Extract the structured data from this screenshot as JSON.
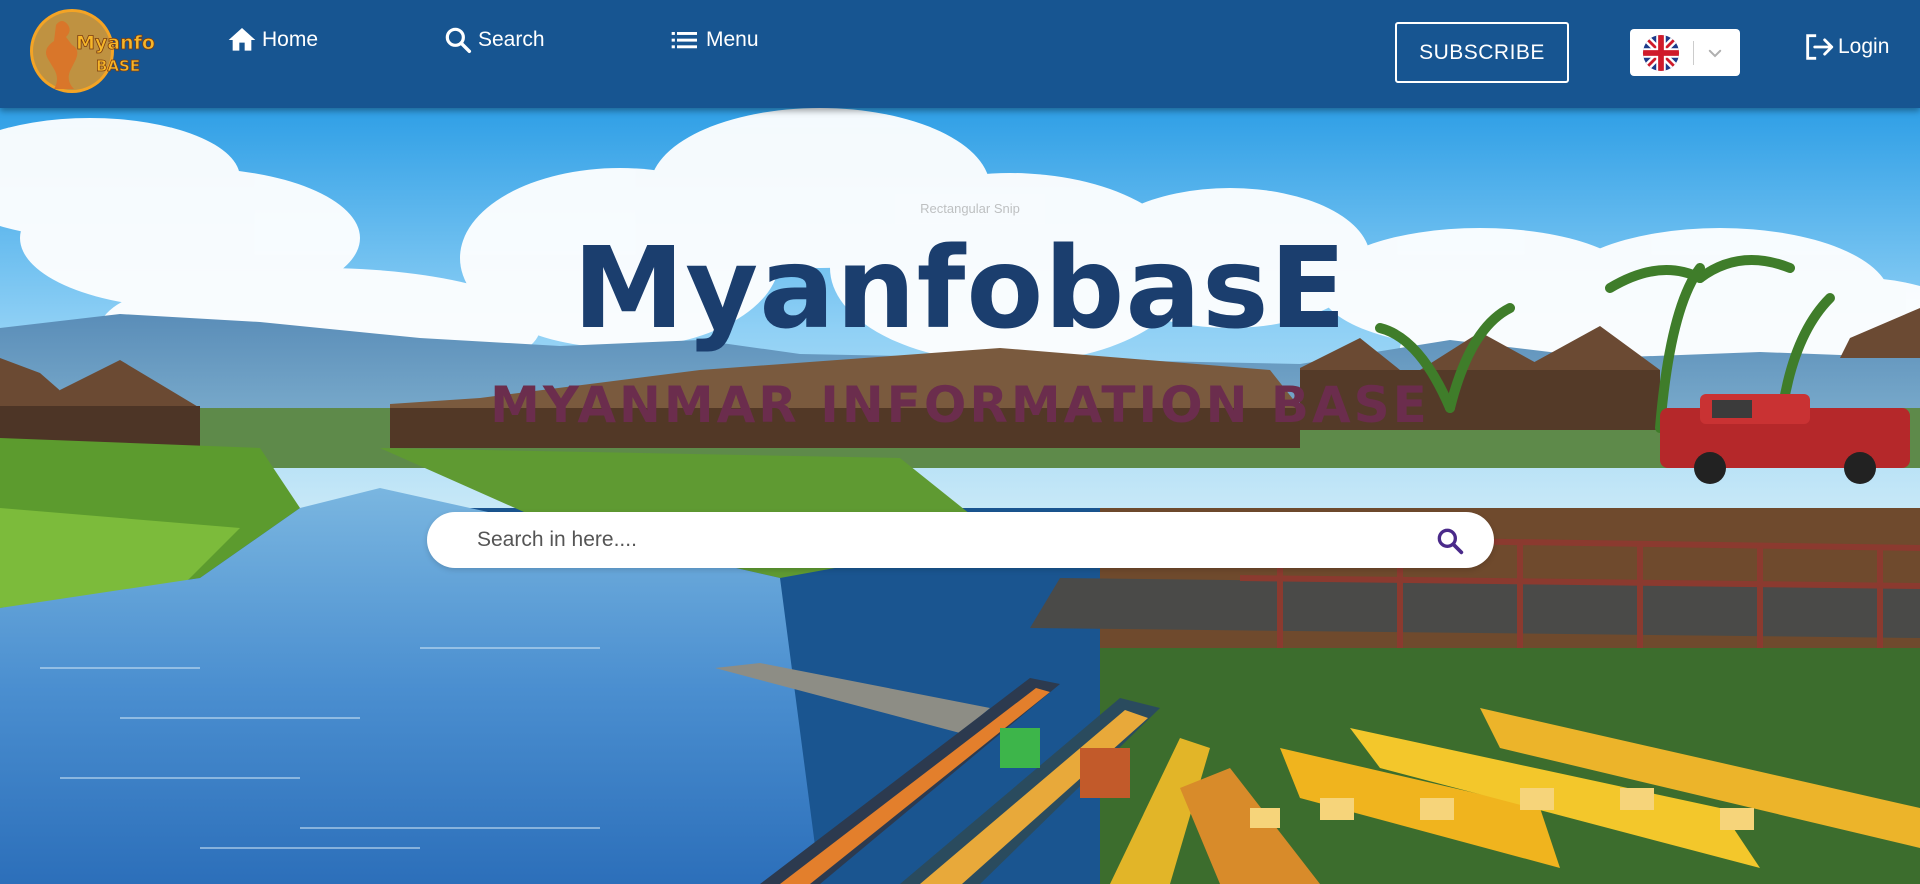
{
  "brand": {
    "logo_text_line1": "Myanfo",
    "logo_text_line2": "BASE"
  },
  "nav": {
    "home_label": "Home",
    "search_label": "Search",
    "menu_label": "Menu"
  },
  "header": {
    "subscribe_label": "SUBSCRIBE",
    "language_icon": "uk-flag-icon",
    "login_label": "Login"
  },
  "hero": {
    "overlay_text": "Rectangular Snip",
    "title": "MyanfobasE",
    "subtitle": "MYANMAR INFORMATION BASE",
    "search_placeholder": "Search in here...."
  },
  "colors": {
    "header_bg": "#175591",
    "title": "#1b3e6e",
    "subtitle": "#6b2d4d",
    "search_icon": "#4a2a8a"
  }
}
